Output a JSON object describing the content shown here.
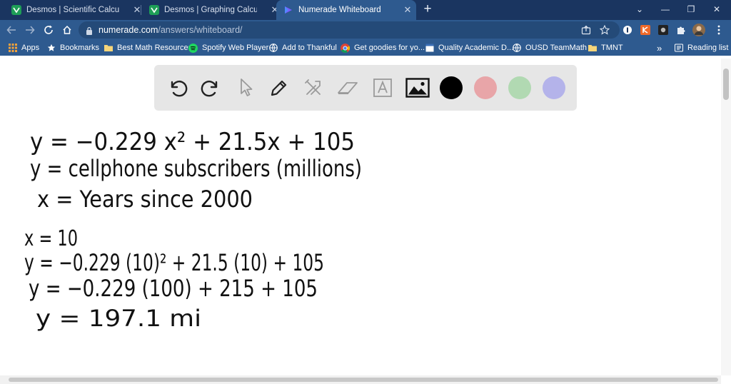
{
  "tabs": [
    {
      "title": "Desmos | Scientific Calculator",
      "active": false
    },
    {
      "title": "Desmos | Graphing Calculator",
      "active": false
    },
    {
      "title": "Numerade Whiteboard",
      "active": true
    }
  ],
  "address": {
    "domain": "numerade.com",
    "path": "/answers/whiteboard/"
  },
  "bookmarks": [
    {
      "label": "Apps",
      "icon": "apps-grid-icon"
    },
    {
      "label": "Bookmarks",
      "icon": "star-icon"
    },
    {
      "label": "Best Math Resources",
      "icon": "folder-icon"
    },
    {
      "label": "Spotify Web Player",
      "icon": "spotify-icon"
    },
    {
      "label": "Add to Thankful",
      "icon": "globe-icon"
    },
    {
      "label": "Get goodies for yo...",
      "icon": "chrome-icon"
    },
    {
      "label": "Quality Academic D...",
      "icon": "doc-icon"
    },
    {
      "label": "OUSD TeamMath",
      "icon": "globe-icon"
    },
    {
      "label": "TMNT",
      "icon": "folder-icon"
    }
  ],
  "reading_list": "Reading list",
  "overflow": "»",
  "whiteboard": {
    "tools": [
      "undo-icon",
      "redo-icon",
      "pointer-icon",
      "pen-icon",
      "tools-icon",
      "eraser-icon",
      "text-icon",
      "image-icon"
    ],
    "colors": [
      "#000000",
      "#e8a5a8",
      "#b1d9b2",
      "#b4b3ea"
    ]
  },
  "handwriting": {
    "line1": "y = −0.229 x² + 21.5x + 105",
    "line2": "y = cellphone subscribers (millions)",
    "line3": "x = Years since 2000",
    "line4": "x = 10",
    "line5": "y = −0.229 (10)² + 21.5 (10) + 105",
    "line6": "y = −0.229 (100) + 215 + 105",
    "line7": "y = 197.1 mi"
  }
}
